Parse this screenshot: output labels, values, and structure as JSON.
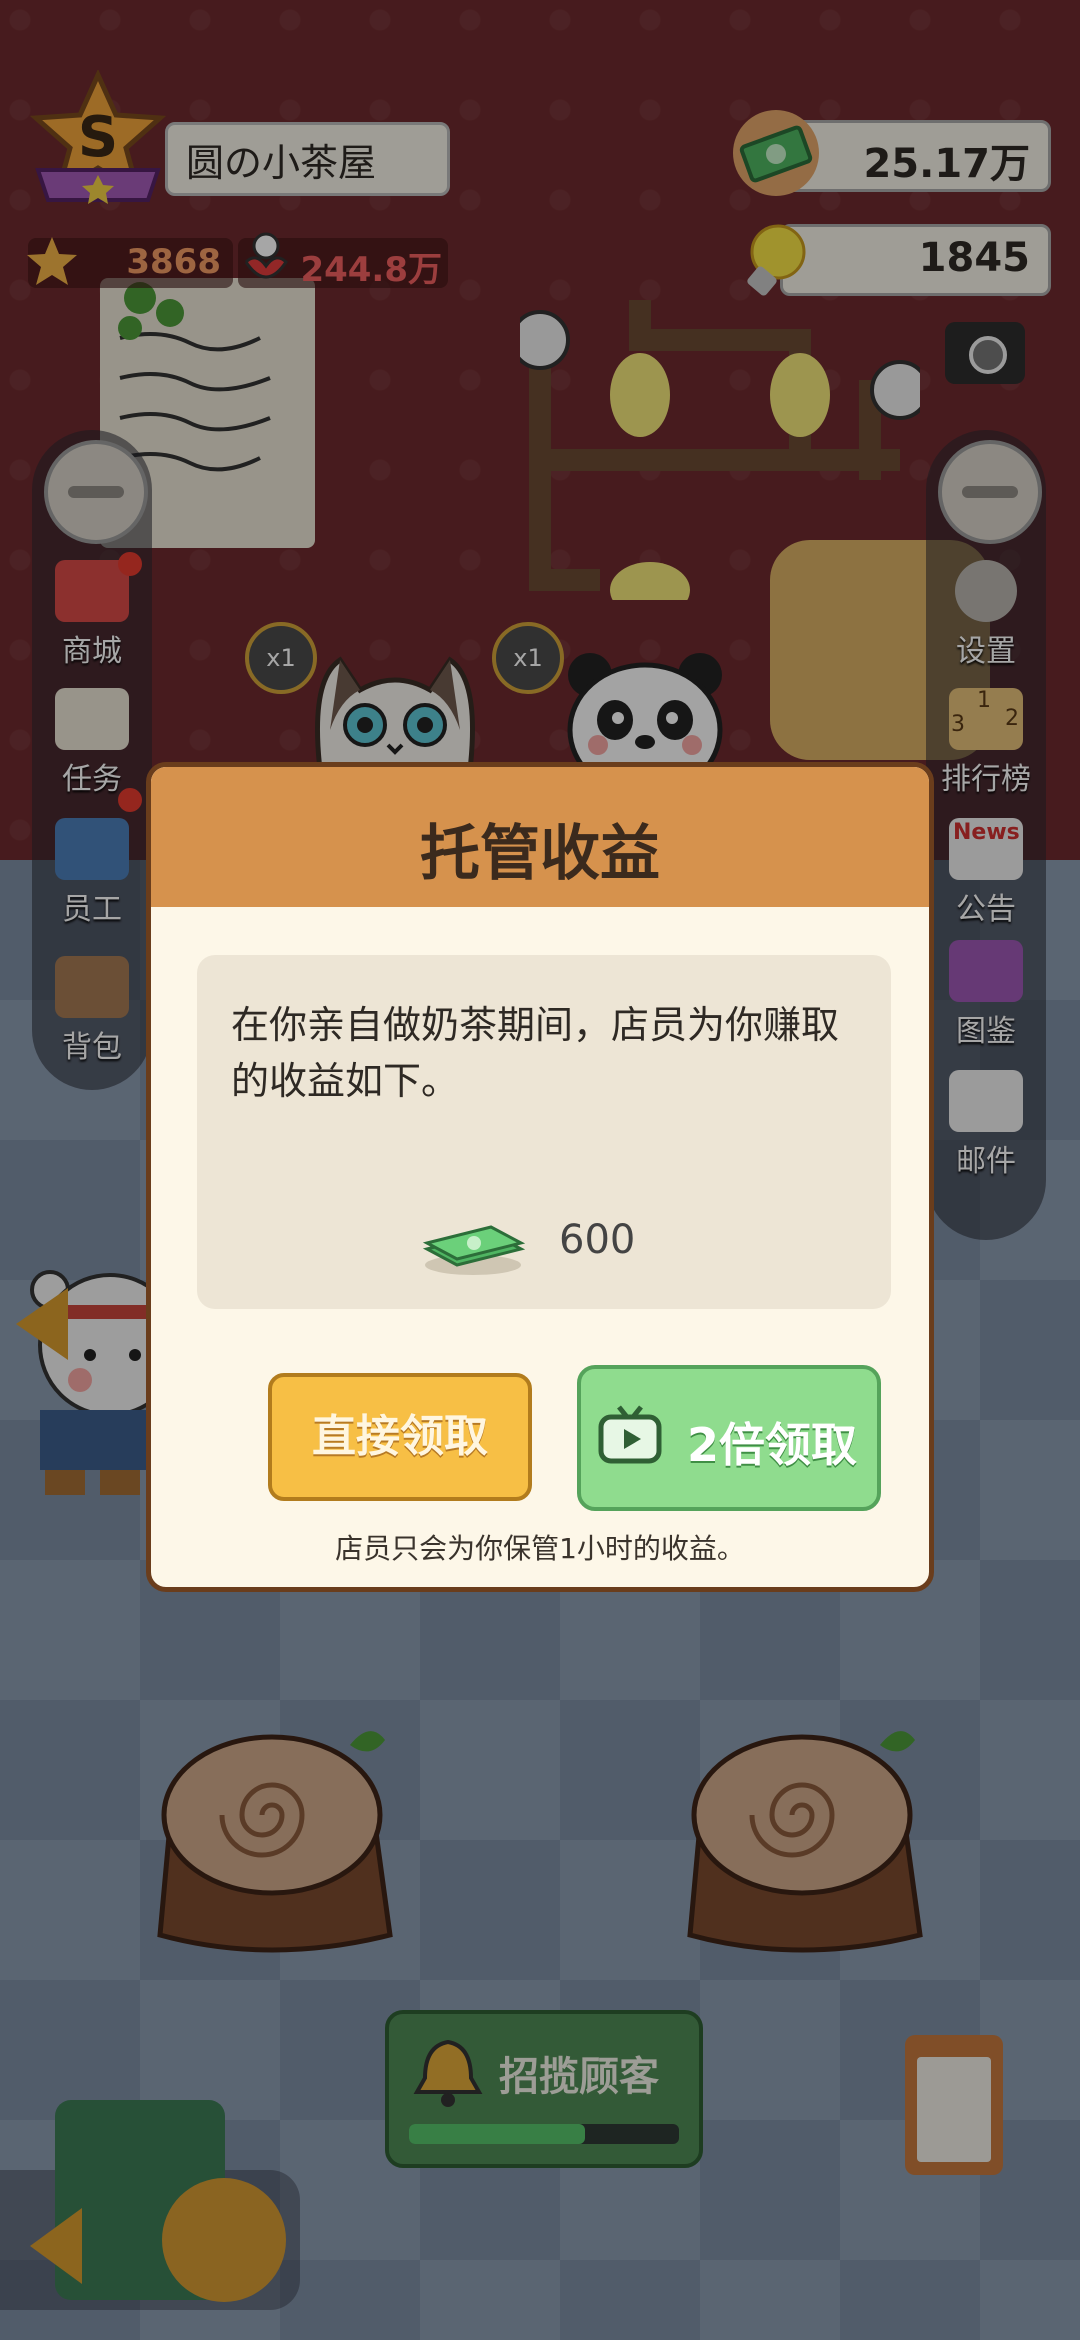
{
  "header": {
    "shop_name": "圆の小茶屋",
    "rank_letter": "S",
    "stars": "3868",
    "fans": "244.8万",
    "money": "25.17万",
    "ideas": "1845"
  },
  "left_menu": [
    {
      "label": "商城",
      "icon": "shop-icon",
      "badge": true
    },
    {
      "label": "任务",
      "icon": "task-icon",
      "badge": false
    },
    {
      "label": "员工",
      "icon": "staff-icon",
      "badge": true
    },
    {
      "label": "背包",
      "icon": "backpack-icon",
      "badge": false
    }
  ],
  "right_menu": [
    {
      "label": "设置",
      "icon": "gear-icon"
    },
    {
      "label": "排行榜",
      "icon": "podium-icon"
    },
    {
      "label": "公告",
      "icon": "news-icon"
    },
    {
      "label": "图鉴",
      "icon": "album-icon"
    },
    {
      "label": "邮件",
      "icon": "mail-icon"
    }
  ],
  "scene": {
    "multiplier_a": "x1",
    "multiplier_b": "x1",
    "ranking_numbers": [
      "1",
      "2",
      "3"
    ],
    "news_label": "News",
    "recruit_button": "招揽顾客",
    "recruit_progress": 0.65
  },
  "dialog": {
    "title": "托管收益",
    "message": "在你亲自做奶茶期间，店员为你赚取的收益如下。",
    "reward_amount": "600",
    "button_direct": "直接领取",
    "button_double": "2倍领取",
    "note": "店员只会为你保管1小时的收益。"
  },
  "colors": {
    "dialog_header": "#d6924d",
    "direct_button": "#f7bf45",
    "double_button": "#8fdc8e",
    "money_text": "#2f2a25"
  }
}
